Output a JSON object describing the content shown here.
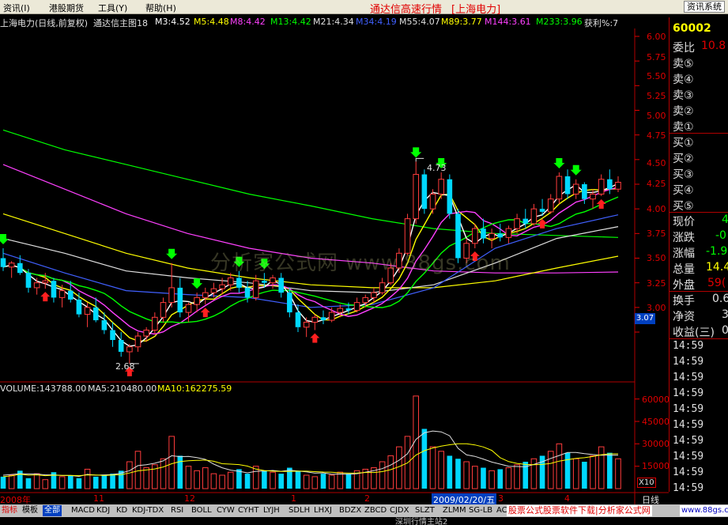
{
  "menu": {
    "items": [
      "资讯(I)",
      "港股期货",
      "工具(Y)",
      "帮助(H)"
    ],
    "app_title": "通达信高速行情",
    "market": "[上海电力]",
    "news_button": "资讯系统"
  },
  "indicator_line": {
    "stock": "上海电力(日线,前复权)",
    "formula": "通达信主图18",
    "ma3": "M3:4.52",
    "ma5": "M5:4.48",
    "ma8": "M8:4.42",
    "ma13": "M13:4.42",
    "ma21": "M21:4.34",
    "ma34": "M34:4.19",
    "ma55": "M55:4.07",
    "ma89": "M89:3.77",
    "ma144": "M144:3.61",
    "ma233": "M233:3.96",
    "profit": "获利%:7"
  },
  "price_axis": [
    "6.00",
    "5.75",
    "5.50",
    "5.25",
    "5.00",
    "4.75",
    "4.50",
    "4.25",
    "4.00",
    "3.75",
    "3.50",
    "3.25",
    "3.00"
  ],
  "current_price_marker": "3.07",
  "high_label": "4.73",
  "low_label": "2.68",
  "volume_line": {
    "volume": "VOLUME:143788.00",
    "ma5": "MA5:210480.00",
    "ma10": "MA10:162275.59"
  },
  "volume_axis": [
    "60000",
    "45000",
    "30000",
    "15000"
  ],
  "volume_unit": "X10",
  "date_axis": {
    "labels": [
      "2008年",
      "11",
      "12",
      "1",
      "2",
      "3",
      "4"
    ],
    "selected_date": "2009/02/20/五",
    "period": "日线"
  },
  "quote": {
    "code": "60002",
    "weibi_label": "委比",
    "weibi_value": "10.8",
    "sell_labels": [
      "卖⑤",
      "卖④",
      "卖③",
      "卖②",
      "卖①"
    ],
    "buy_labels": [
      "买①",
      "买②",
      "买③",
      "买④",
      "买⑤"
    ],
    "stats": [
      {
        "label": "现价",
        "value": "4"
      },
      {
        "label": "涨跌",
        "value": "-0"
      },
      {
        "label": "涨幅",
        "value": "-1.9"
      },
      {
        "label": "总量",
        "value": "14.4"
      },
      {
        "label": "外盘",
        "value": "59("
      },
      {
        "label": "换手",
        "value": "0.6"
      },
      {
        "label": "净资",
        "value": "3"
      },
      {
        "label": "收益(三)",
        "value": "0"
      }
    ],
    "times": [
      "14:59",
      "14:59",
      "14:59",
      "14:59",
      "14:59",
      "14:59",
      "14:59",
      "14:59",
      "14:59",
      "14:59",
      "14:59",
      "14:59",
      "14:59",
      "14:59",
      "14:59",
      "14:59"
    ]
  },
  "indicator_tabs": [
    "指标",
    "模板",
    "全部",
    "MACD",
    "KDJ",
    "KD",
    "KDJ-TDX",
    "RSI",
    "BOLL",
    "CYW",
    "CYHT",
    "LYJH",
    "SDLH",
    "LHXJ",
    "BDZX",
    "ZBCD",
    "CJDX",
    "SLZT",
    "ZLMM",
    "SG-LB",
    "AC"
  ],
  "download_banner": "股票公式股票软件下载|分析家公式网",
  "download_url": "www.88gs.com",
  "status_text": "深圳行情主站2",
  "watermark": "分析家公式网 www.88gs.com",
  "colors": {
    "up": "#ff3c3c",
    "down": "#00d8ff",
    "axis_red": "#e00000",
    "ma3": "#ffffff",
    "ma5": "#ffff00",
    "ma8": "#ff40ff",
    "ma13": "#00ff00",
    "ma21": "#e0e0e0",
    "ma34": "#4060ff",
    "ma55": "#e0e0e0",
    "ma89": "#ffff00",
    "ma144": "#ff40ff",
    "ma233": "#00ff00",
    "profit": "#e0e0e0"
  },
  "chart_data": {
    "type": "line",
    "candles": [
      [
        3.75,
        3.85,
        3.62,
        3.66
      ],
      [
        3.66,
        3.72,
        3.55,
        3.7
      ],
      [
        3.7,
        3.78,
        3.58,
        3.6
      ],
      [
        3.6,
        3.64,
        3.4,
        3.45
      ],
      [
        3.45,
        3.55,
        3.38,
        3.5
      ],
      [
        3.5,
        3.6,
        3.44,
        3.52
      ],
      [
        3.52,
        3.55,
        3.3,
        3.35
      ],
      [
        3.35,
        3.48,
        3.25,
        3.42
      ],
      [
        3.42,
        3.52,
        3.3,
        3.33
      ],
      [
        3.33,
        3.4,
        3.15,
        3.18
      ],
      [
        3.18,
        3.3,
        3.05,
        3.25
      ],
      [
        3.25,
        3.35,
        3.1,
        3.12
      ],
      [
        3.12,
        3.2,
        2.98,
        3.02
      ],
      [
        3.02,
        3.1,
        2.85,
        2.92
      ],
      [
        2.92,
        3.0,
        2.75,
        2.8
      ],
      [
        2.8,
        2.88,
        2.68,
        2.85
      ],
      [
        2.85,
        3.0,
        2.8,
        2.96
      ],
      [
        2.96,
        3.05,
        2.9,
        3.02
      ],
      [
        3.02,
        3.2,
        2.98,
        3.15
      ],
      [
        3.15,
        3.35,
        3.1,
        3.3
      ],
      [
        3.3,
        3.7,
        3.25,
        3.45
      ],
      [
        3.45,
        3.55,
        3.15,
        3.2
      ],
      [
        3.2,
        3.3,
        3.1,
        3.28
      ],
      [
        3.28,
        3.4,
        3.2,
        3.35
      ],
      [
        3.35,
        3.45,
        3.28,
        3.4
      ],
      [
        3.4,
        3.5,
        3.35,
        3.44
      ],
      [
        3.44,
        3.55,
        3.38,
        3.48
      ],
      [
        3.48,
        3.6,
        3.42,
        3.55
      ],
      [
        3.55,
        3.62,
        3.4,
        3.45
      ],
      [
        3.45,
        3.52,
        3.3,
        3.35
      ],
      [
        3.35,
        3.58,
        3.32,
        3.52
      ],
      [
        3.52,
        3.6,
        3.45,
        3.5
      ],
      [
        3.5,
        3.58,
        3.44,
        3.55
      ],
      [
        3.55,
        3.6,
        3.35,
        3.4
      ],
      [
        3.4,
        3.45,
        3.15,
        3.2
      ],
      [
        3.2,
        3.28,
        3.0,
        3.05
      ],
      [
        3.05,
        3.15,
        2.95,
        3.1
      ],
      [
        3.1,
        3.18,
        3.02,
        3.15
      ],
      [
        3.15,
        3.22,
        3.08,
        3.12
      ],
      [
        3.12,
        3.25,
        3.1,
        3.2
      ],
      [
        3.2,
        3.28,
        3.15,
        3.24
      ],
      [
        3.24,
        3.3,
        3.18,
        3.22
      ],
      [
        3.22,
        3.35,
        3.2,
        3.3
      ],
      [
        3.3,
        3.38,
        3.25,
        3.35
      ],
      [
        3.35,
        3.45,
        3.3,
        3.4
      ],
      [
        3.4,
        3.55,
        3.38,
        3.5
      ],
      [
        3.5,
        3.7,
        3.48,
        3.65
      ],
      [
        3.65,
        3.85,
        3.6,
        3.8
      ],
      [
        3.8,
        4.2,
        3.78,
        4.15
      ],
      [
        4.15,
        4.73,
        4.1,
        4.6
      ],
      [
        4.6,
        4.65,
        4.2,
        4.25
      ],
      [
        4.25,
        4.45,
        4.2,
        4.4
      ],
      [
        4.4,
        4.62,
        4.35,
        4.55
      ],
      [
        4.55,
        4.6,
        4.15,
        4.2
      ],
      [
        4.2,
        4.25,
        3.7,
        3.75
      ],
      [
        3.75,
        3.95,
        3.7,
        3.9
      ],
      [
        3.9,
        4.1,
        3.85,
        4.05
      ],
      [
        4.05,
        4.15,
        3.9,
        3.95
      ],
      [
        3.95,
        4.05,
        3.85,
        4.0
      ],
      [
        4.0,
        4.1,
        3.92,
        3.96
      ],
      [
        3.96,
        4.08,
        3.9,
        4.05
      ],
      [
        4.05,
        4.2,
        4.0,
        4.15
      ],
      [
        4.15,
        4.25,
        4.05,
        4.1
      ],
      [
        4.1,
        4.3,
        4.08,
        4.25
      ],
      [
        4.25,
        4.35,
        4.18,
        4.22
      ],
      [
        4.22,
        4.4,
        4.2,
        4.35
      ],
      [
        4.35,
        4.62,
        4.3,
        4.58
      ],
      [
        4.58,
        4.65,
        4.35,
        4.4
      ],
      [
        4.4,
        4.55,
        4.35,
        4.5
      ],
      [
        4.5,
        4.52,
        4.3,
        4.35
      ],
      [
        4.35,
        4.45,
        4.25,
        4.4
      ],
      [
        4.4,
        4.6,
        4.38,
        4.55
      ],
      [
        4.55,
        4.65,
        4.4,
        4.45
      ],
      [
        4.45,
        4.58,
        4.42,
        4.52
      ]
    ],
    "volumes": [
      8000,
      9000,
      12000,
      7000,
      10000,
      6000,
      11000,
      8000,
      9000,
      7000,
      13000,
      8000,
      9000,
      10000,
      12000,
      18000,
      25000,
      14000,
      16000,
      20000,
      35000,
      22000,
      15000,
      12000,
      14000,
      10000,
      9000,
      11000,
      13000,
      10000,
      15000,
      12000,
      11000,
      10000,
      14000,
      12000,
      9000,
      8000,
      10000,
      9000,
      11000,
      10000,
      12000,
      13000,
      14000,
      18000,
      22000,
      28000,
      35000,
      62000,
      40000,
      28000,
      25000,
      22000,
      20000,
      18000,
      15000,
      14000,
      12000,
      13000,
      14000,
      16000,
      18000,
      20000,
      22000,
      25000,
      30000,
      24000,
      20000,
      18000,
      22000,
      28000,
      24000,
      20000
    ],
    "volume_ma5": [
      9000,
      9500,
      10000,
      9800,
      9800,
      9200,
      9200,
      8800,
      8800,
      8200,
      9600,
      9000,
      9200,
      9400,
      10400,
      12000,
      15400,
      16000,
      17000,
      18600,
      22000,
      21400,
      21600,
      20800,
      19600,
      16400,
      14000,
      12400,
      11600,
      10600,
      11600,
      11800,
      12200,
      11600,
      12400,
      11800,
      11200,
      10400,
      10600,
      9600,
      9800,
      9600,
      10000,
      11000,
      12000,
      13400,
      15800,
      19000,
      23400,
      33000,
      37400,
      38600,
      38000,
      35400,
      27000,
      22600,
      21600,
      19800,
      17800,
      16400,
      15000,
      14800,
      14600,
      16200,
      18000,
      20200,
      22200,
      24200,
      24200,
      23400,
      22800,
      22400,
      22400,
      22400
    ],
    "ma_lines": {
      "ma233": [
        5.05,
        4.85,
        4.7,
        4.55,
        4.4,
        4.28,
        4.15,
        4.05,
        4.0,
        3.98,
        3.96
      ],
      "ma144": [
        4.7,
        4.45,
        4.2,
        4.0,
        3.85,
        3.75,
        3.7,
        3.62,
        3.6,
        3.6,
        3.61
      ],
      "ma89": [
        4.2,
        4.0,
        3.8,
        3.65,
        3.55,
        3.48,
        3.45,
        3.45,
        3.52,
        3.65,
        3.77
      ],
      "ma55": [
        3.95,
        3.8,
        3.62,
        3.55,
        3.5,
        3.42,
        3.4,
        3.48,
        3.7,
        3.95,
        4.07
      ],
      "ma34": [
        3.8,
        3.6,
        3.42,
        3.38,
        3.35,
        3.25,
        3.28,
        3.45,
        3.85,
        4.05,
        4.19
      ]
    },
    "ylim": [
      2.6,
      6.1
    ],
    "y_ticks": [
      6.0,
      5.75,
      5.5,
      5.25,
      5.0,
      4.75,
      4.5,
      4.25,
      4.0,
      3.75,
      3.5,
      3.25,
      3.0
    ],
    "volume_ylim": [
      0,
      65000
    ],
    "volume_ticks": [
      60000,
      45000,
      30000,
      15000
    ]
  }
}
